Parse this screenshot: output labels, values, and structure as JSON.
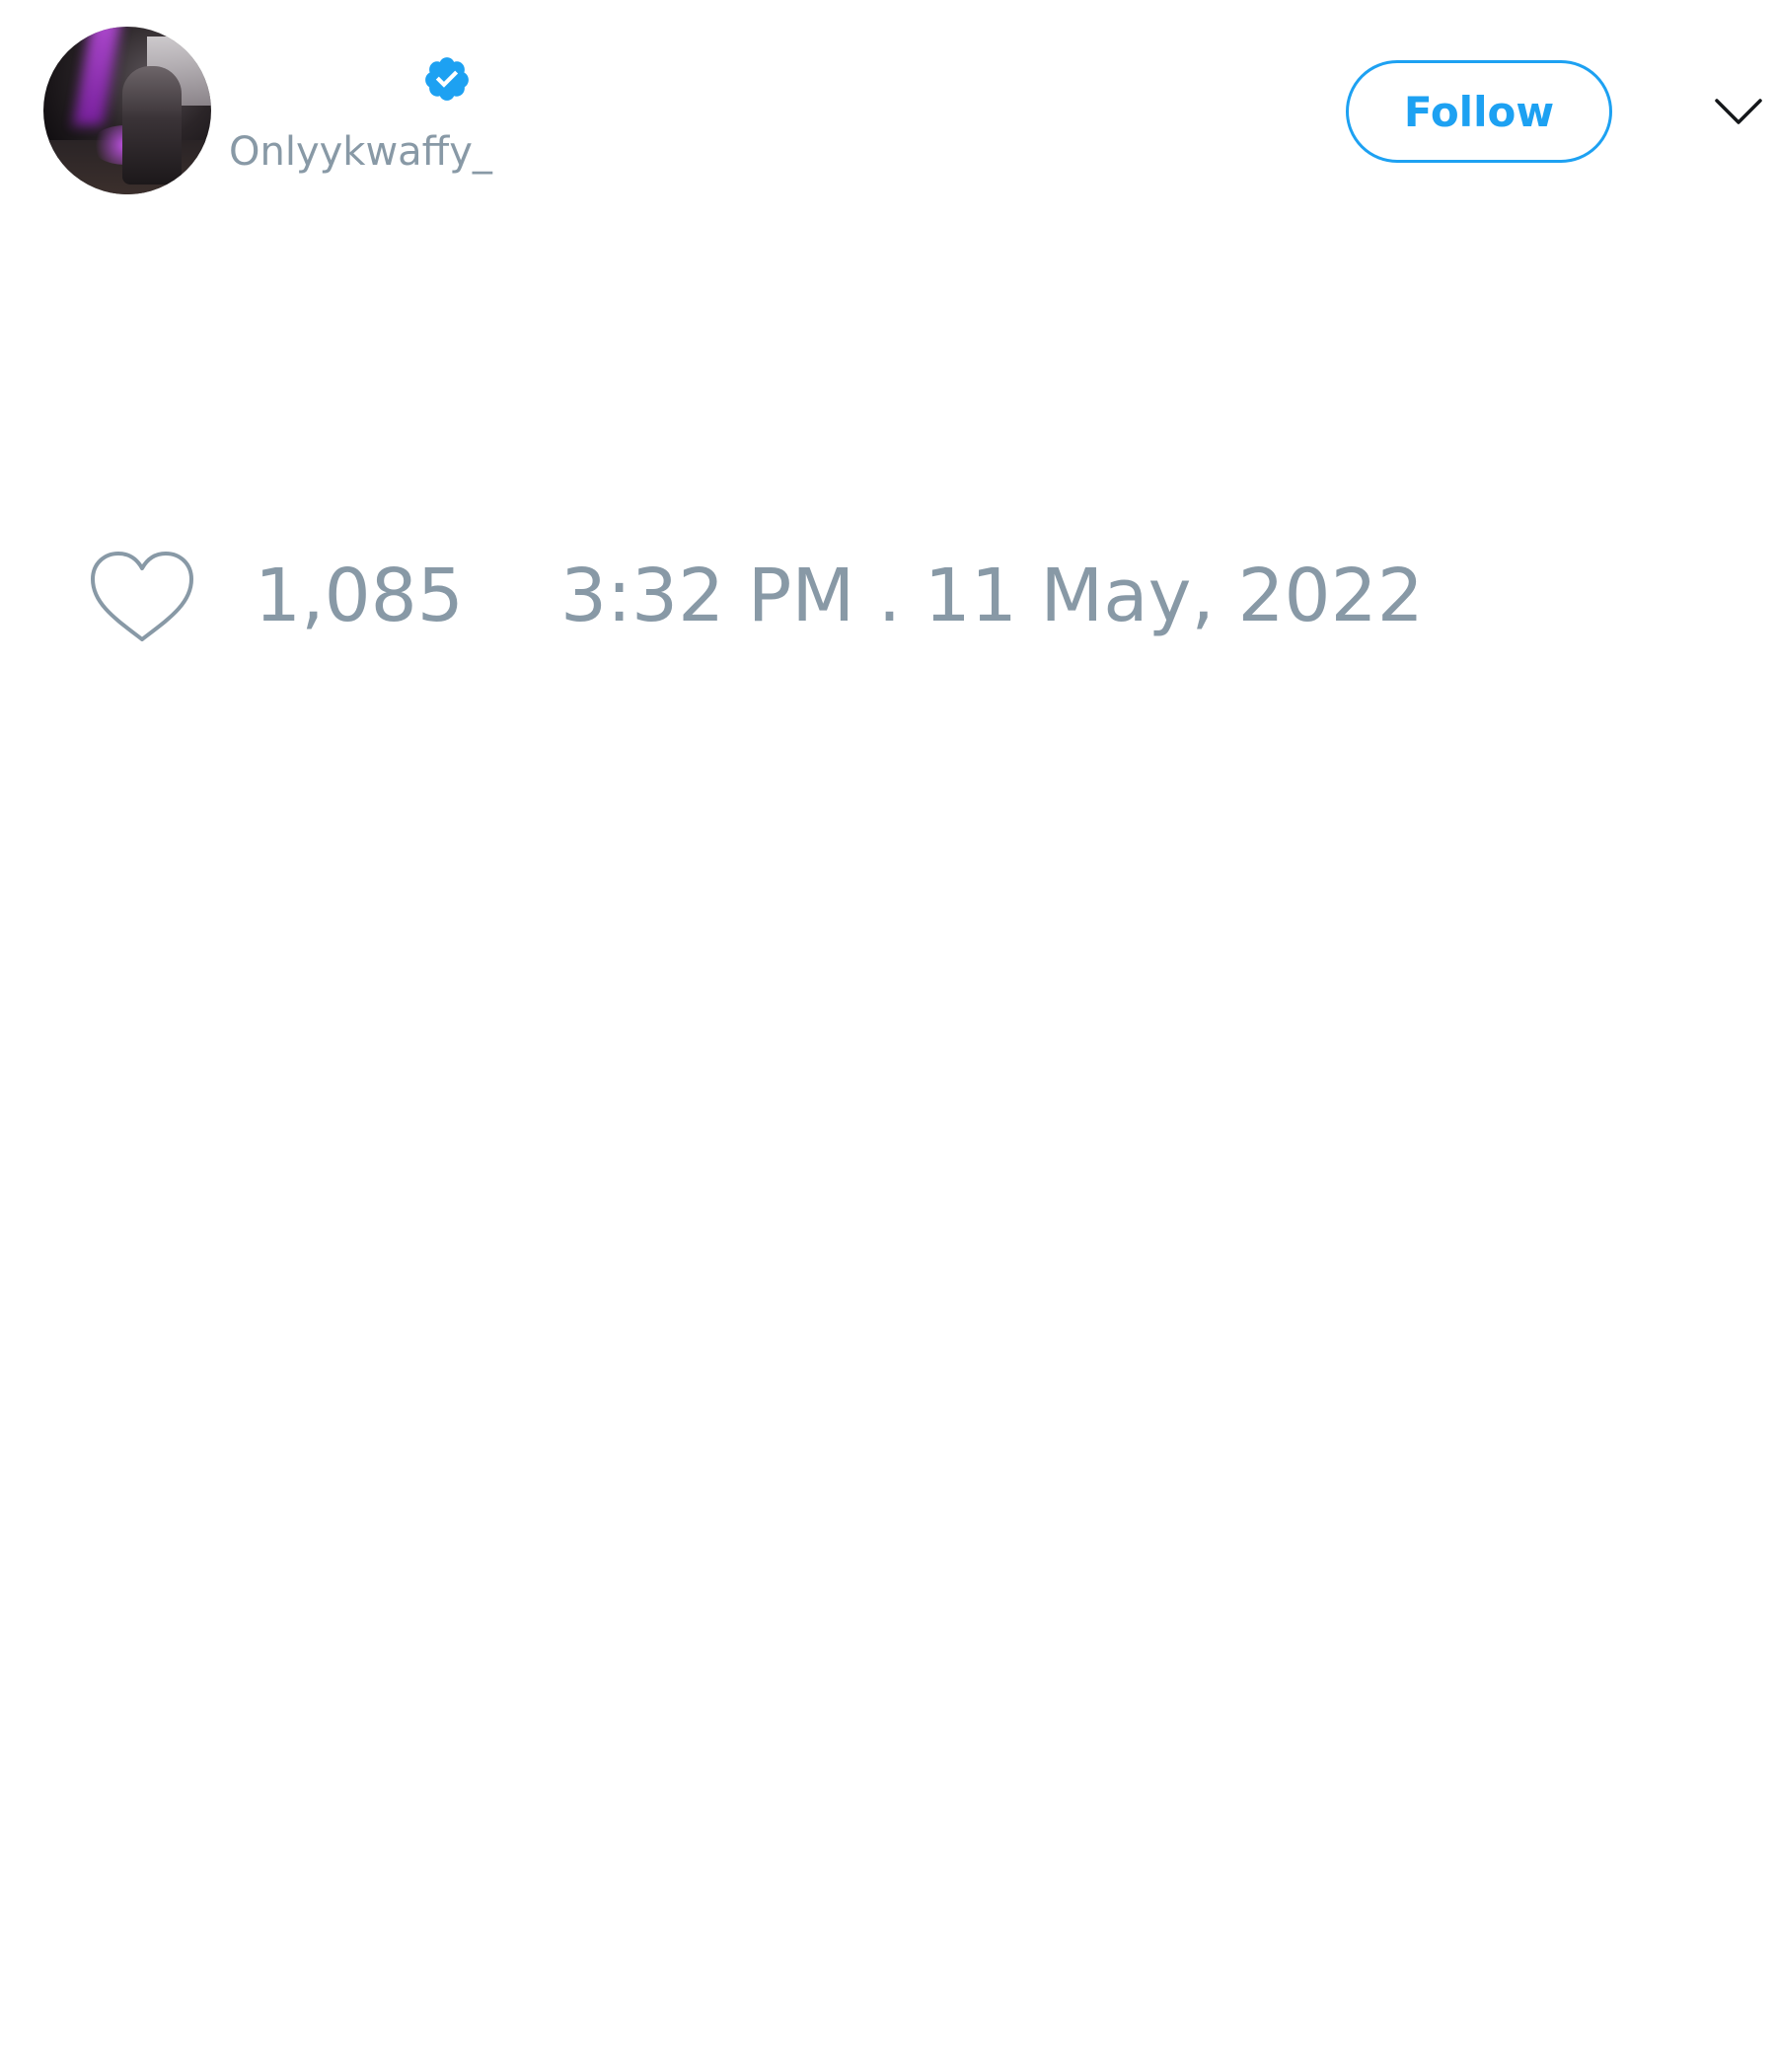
{
  "tweet": {
    "author": {
      "display_name": "",
      "handle": "Onlyykwaffy_",
      "verified_icon": "verified-badge-icon",
      "avatar_icon": "profile-avatar"
    },
    "follow_label": "Follow",
    "menu_icon": "chevron-down-icon",
    "like_icon": "heart-outline-icon",
    "like_count": "1,085",
    "timestamp": "3:32 PM . 11 May, 2022"
  },
  "colors": {
    "accent": "#1da1f2",
    "muted_text": "#8899a6",
    "background": "#ffffff",
    "icon_dark": "#14171a"
  }
}
